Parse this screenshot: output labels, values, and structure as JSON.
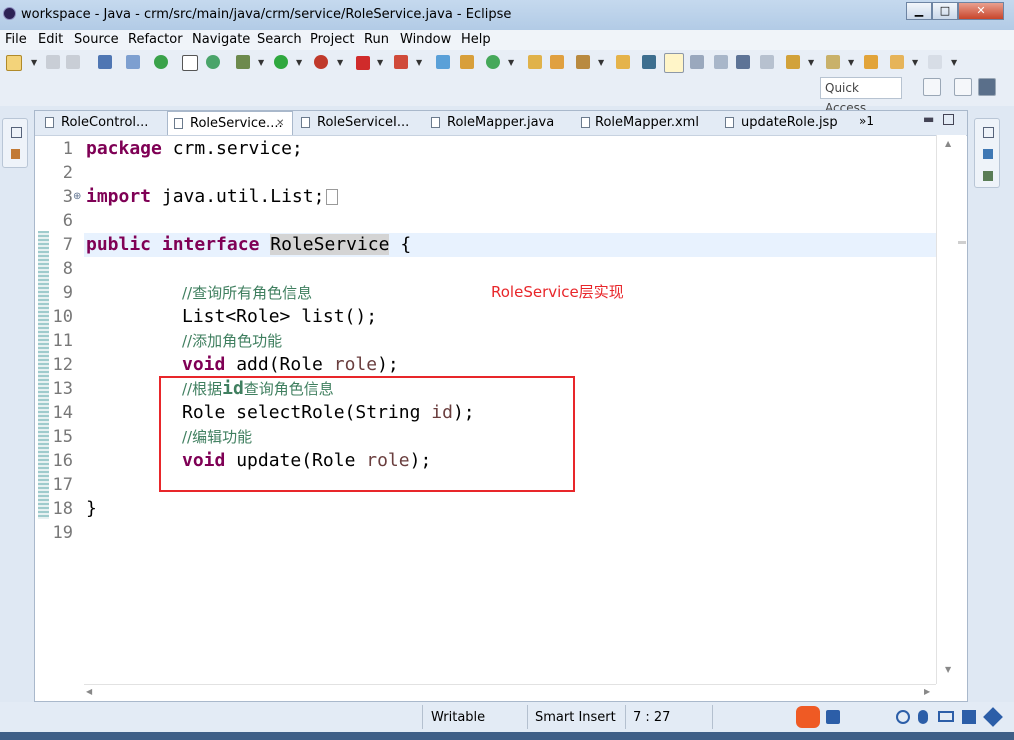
{
  "window": {
    "title": "workspace - Java - crm/src/main/java/crm/service/RoleService.java - Eclipse",
    "minimize_glyph": "▁",
    "maximize_glyph": "□",
    "close_glyph": "✕"
  },
  "menubar": [
    "File",
    "Edit",
    "Source",
    "Refactor",
    "Navigate",
    "Search",
    "Project",
    "Run",
    "Window",
    "Help"
  ],
  "toolbar": {
    "quick_access_label": "Quick Access",
    "icons": [
      "new-icon",
      "save-icon",
      "save-all-icon",
      "print-icon",
      "toggle-breakpoint-icon",
      "debug-icon",
      "run-icon",
      "stop-icon",
      "open-type-icon",
      "search-icon",
      "back-icon",
      "forward-icon"
    ]
  },
  "editor": {
    "tabs": [
      {
        "label": "RoleControl...",
        "icon": "J"
      },
      {
        "label": "RoleService....",
        "icon": "J",
        "active": true,
        "close": "✕"
      },
      {
        "label": "RoleServiceI...",
        "icon": "J"
      },
      {
        "label": "RoleMapper.java",
        "icon": "J"
      },
      {
        "label": "RoleMapper.xml",
        "icon": "X"
      },
      {
        "label": "updateRole.jsp",
        "icon": "J"
      }
    ],
    "overflow_label": "»1",
    "line_numbers": [
      "1",
      "2",
      "3",
      "6",
      "7",
      "8",
      "9",
      "10",
      "11",
      "12",
      "13",
      "14",
      "15",
      "16",
      "17",
      "18",
      "19"
    ],
    "code": {
      "l1_kw": "package",
      "l1_rest": " crm.service;",
      "l3_kw": "import",
      "l3_rest": " java.util.List;",
      "l7_kw1": "public",
      "l7_kw2": "interface",
      "l7_name": "RoleService",
      "l7_brace": " {",
      "l9_comment": "//查询所有角色信息",
      "l10": "List<Role> list();",
      "l11_comment": "//添加角色功能",
      "l12_kw": "void",
      "l12_rest": " add(Role ",
      "l12_param": "role",
      "l12_end": ");",
      "l13_prefix": "//根据",
      "l13_id": "id",
      "l13_suffix": "查询角色信息",
      "l14_rest": "Role selectRole(String ",
      "l14_param": "id",
      "l14_end": ");",
      "l15_comment": "//编辑功能",
      "l16_kw": "void",
      "l16_rest": " update(Role ",
      "l16_param": "role",
      "l16_end": ");",
      "l18": "}"
    },
    "annotation_text": "RoleService层实现"
  },
  "statusbar": {
    "writable": "Writable",
    "insert_mode": "Smart Insert",
    "position": "7 : 27"
  },
  "colors": {
    "keyword": "#7f0055",
    "comment": "#3f7f5f",
    "parameter": "#6a3e3e",
    "annotation": "#e8262a",
    "current_line": "#e8f2fe"
  }
}
